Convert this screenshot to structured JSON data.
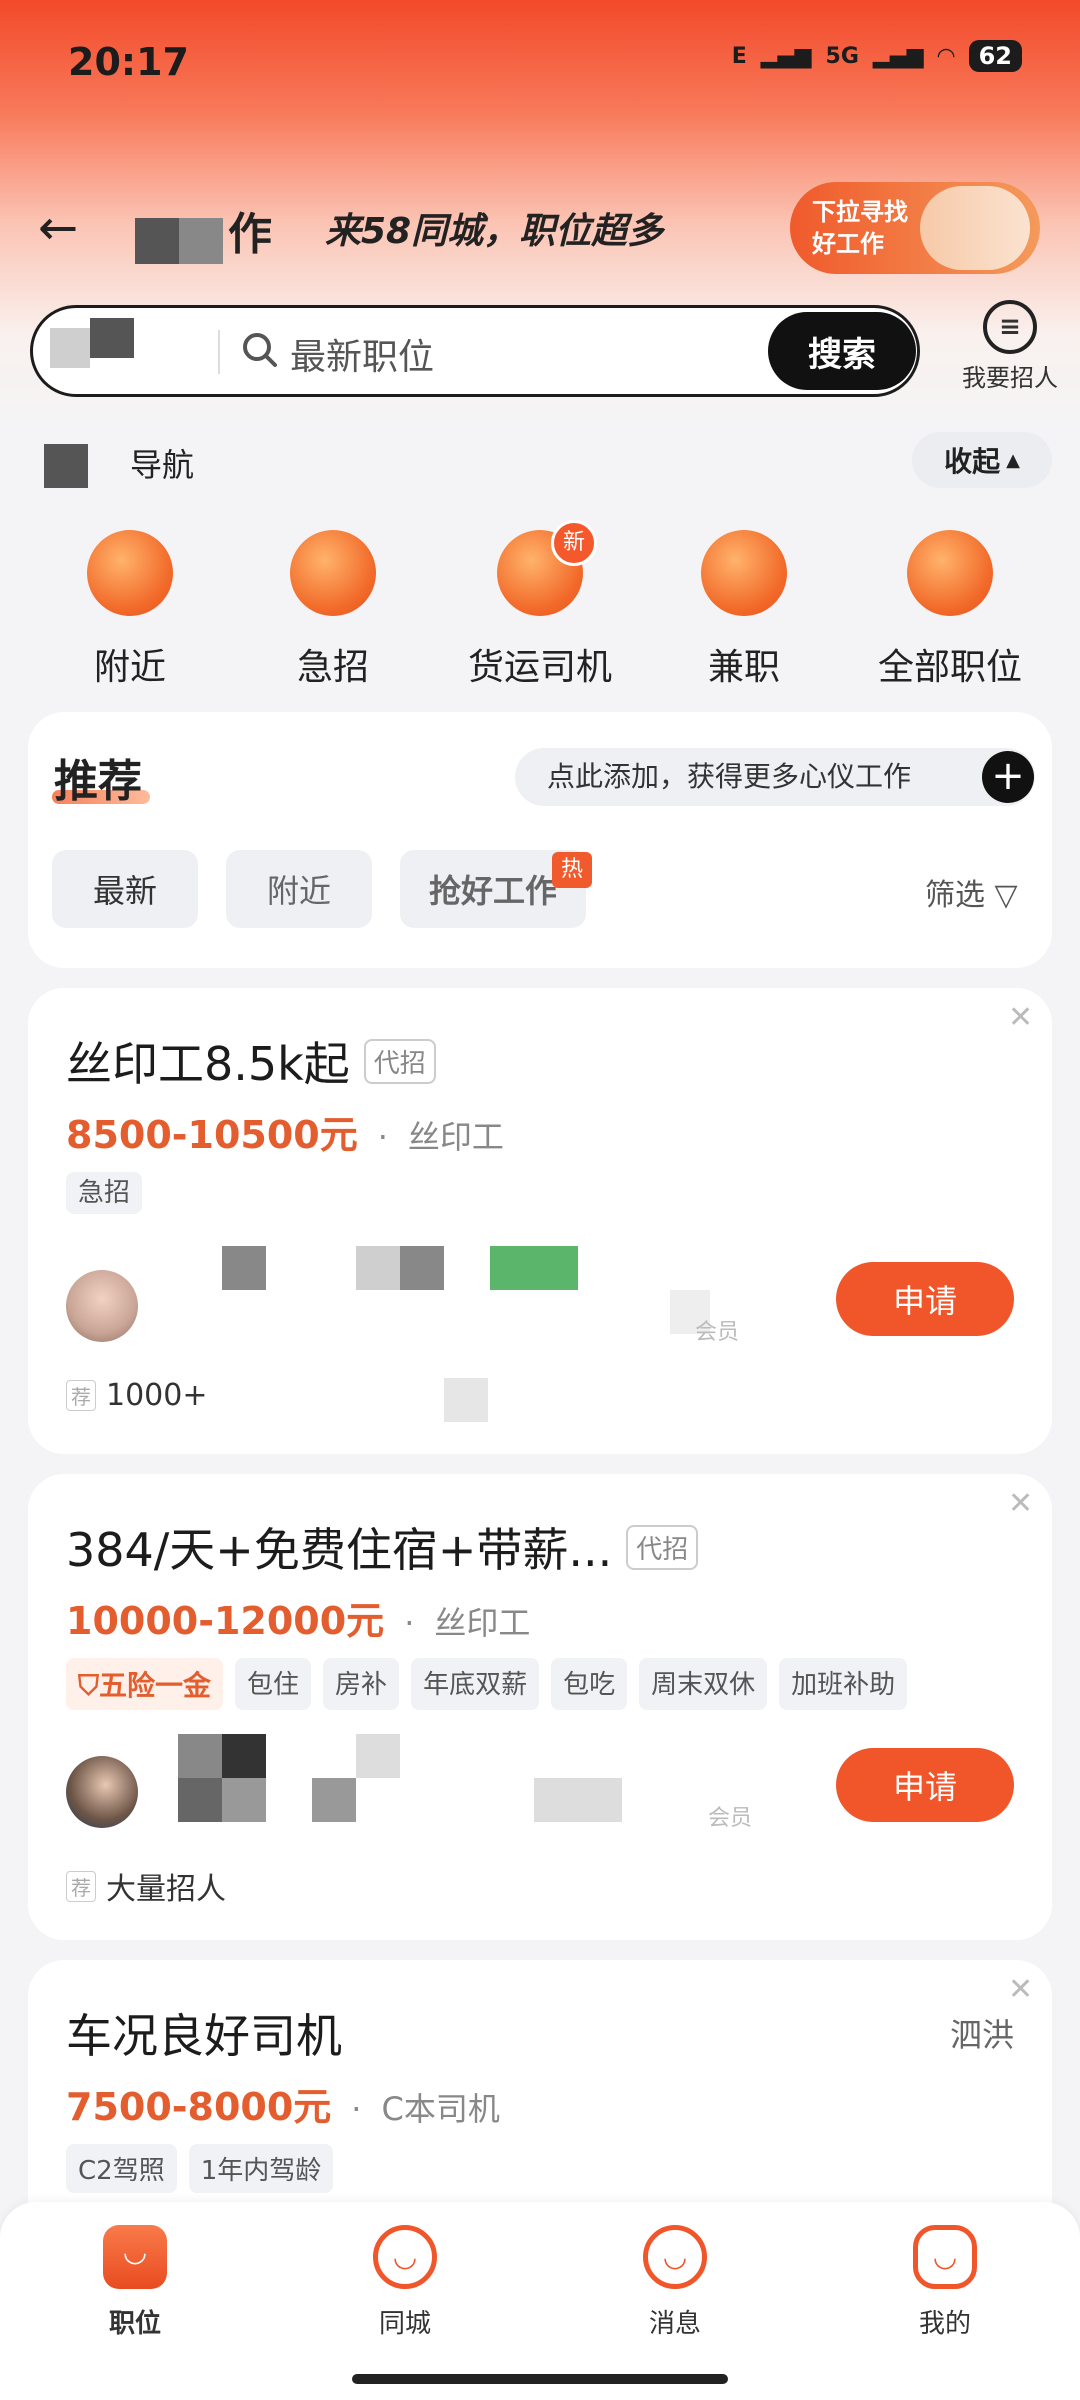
{
  "status_bar": {
    "time": "20:17",
    "network_1": "E",
    "network_2": "5G",
    "battery": "62"
  },
  "header": {
    "title_partial": "找工作",
    "slogan": "来58同城，职位超多",
    "promo_text": "下拉寻找好工作"
  },
  "search": {
    "placeholder": "最新职位",
    "button_label": "搜索",
    "recruit_label": "我要招人"
  },
  "navigation": {
    "title": "导航",
    "collapse_label": "收起",
    "categories": [
      {
        "label": "附近",
        "icon": "location-pin-icon"
      },
      {
        "label": "急招",
        "icon": "lightning-icon"
      },
      {
        "label": "货运司机",
        "icon": "steering-wheel-icon",
        "badge": "新"
      },
      {
        "label": "兼职",
        "icon": "clock-bag-icon"
      },
      {
        "label": "全部职位",
        "icon": "more-dots-icon"
      }
    ]
  },
  "recommend": {
    "title": "推荐",
    "add_prompt": "点此添加，获得更多心仪工作",
    "filter_tabs": [
      "最新",
      "附近",
      "抢好工作"
    ],
    "hot_badge": "热",
    "filter_label": "筛选"
  },
  "jobs": [
    {
      "title": "丝印工8.5k起",
      "agent_tag": "代招",
      "salary": "8500-10500元",
      "type": "丝印工",
      "tags": [
        "急招"
      ],
      "member": "会员",
      "apply_label": "申请",
      "rec_mark": "荐",
      "bottom_note": "1000+"
    },
    {
      "title": "384/天+免费住宿+带薪...",
      "agent_tag": "代招",
      "salary": "10000-12000元",
      "type": "丝印工",
      "accent_tag": "五险一金",
      "tags": [
        "包住",
        "房补",
        "年底双薪",
        "包吃",
        "周末双休",
        "加班补助"
      ],
      "member": "会员",
      "apply_label": "申请",
      "rec_mark": "荐",
      "bottom_note": "大量招人"
    },
    {
      "title": "车况良好司机",
      "location": "泗洪",
      "salary": "7500-8000元",
      "type": "C本司机",
      "tags": [
        "C2驾照",
        "1年内驾龄"
      ]
    }
  ],
  "tabbar": {
    "items": [
      {
        "label": "职位",
        "icon": "briefcase-icon"
      },
      {
        "label": "同城",
        "icon": "smile-icon"
      },
      {
        "label": "消息",
        "icon": "message-icon"
      },
      {
        "label": "我的",
        "icon": "profile-icon"
      }
    ]
  },
  "colors": {
    "accent": "#F0562A",
    "salary": "#E35D2E",
    "dark": "#1C1C1C"
  }
}
